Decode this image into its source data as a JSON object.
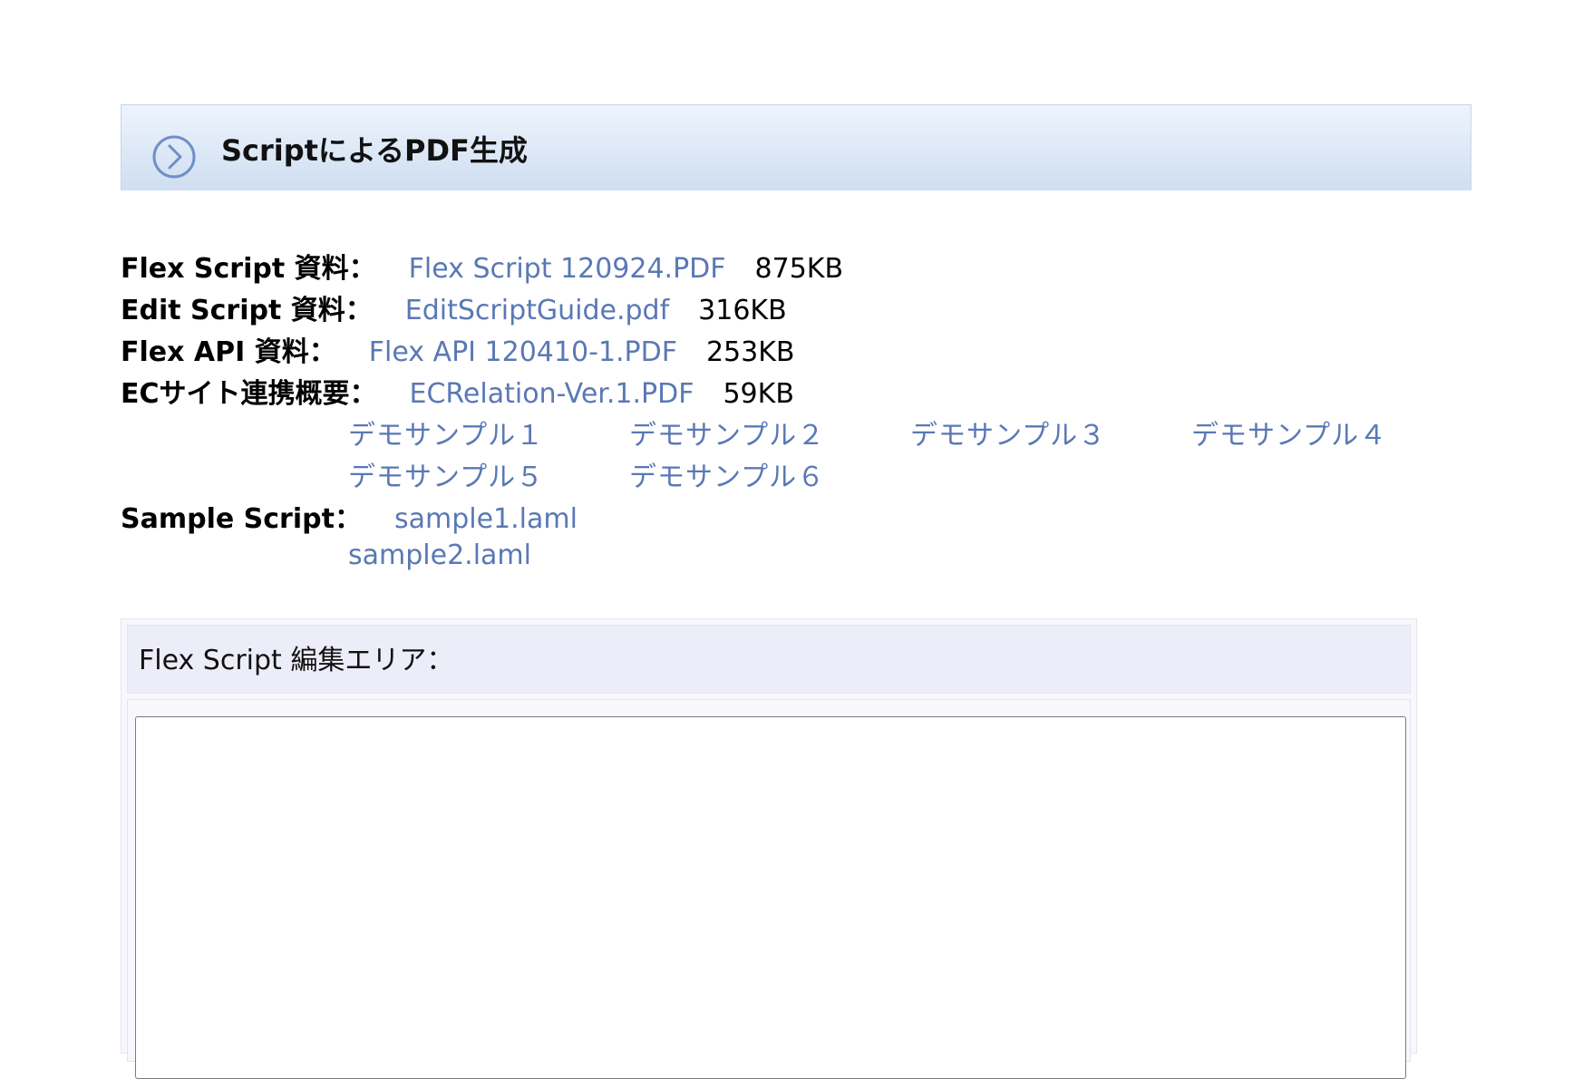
{
  "header": {
    "title": "ScriptによるPDF生成",
    "icon": "chevron-right-circle-icon"
  },
  "documents": [
    {
      "label": "Flex Script 資料：",
      "link": "Flex Script 120924.PDF",
      "size": "875KB"
    },
    {
      "label": "Edit Script 資料：",
      "link": "EditScriptGuide.pdf",
      "size": "316KB"
    },
    {
      "label": "Flex API 資料：",
      "link": "Flex API 120410-1.PDF",
      "size": "253KB"
    },
    {
      "label": "ECサイト連携概要：",
      "link": "ECRelation-Ver.1.PDF",
      "size": "59KB"
    }
  ],
  "demos": [
    "デモサンプル１",
    "デモサンプル２",
    "デモサンプル３",
    "デモサンプル４",
    "デモサンプル５",
    "デモサンプル６"
  ],
  "sample_script": {
    "label": "Sample Script：",
    "files": [
      "sample1.laml",
      "sample2.laml"
    ]
  },
  "editor": {
    "label": "Flex Script 編集エリア：",
    "value": ""
  },
  "colors": {
    "link": "#5a78b5",
    "header_bg": "#dbe7f6",
    "editor_head_bg": "#ededfa"
  }
}
